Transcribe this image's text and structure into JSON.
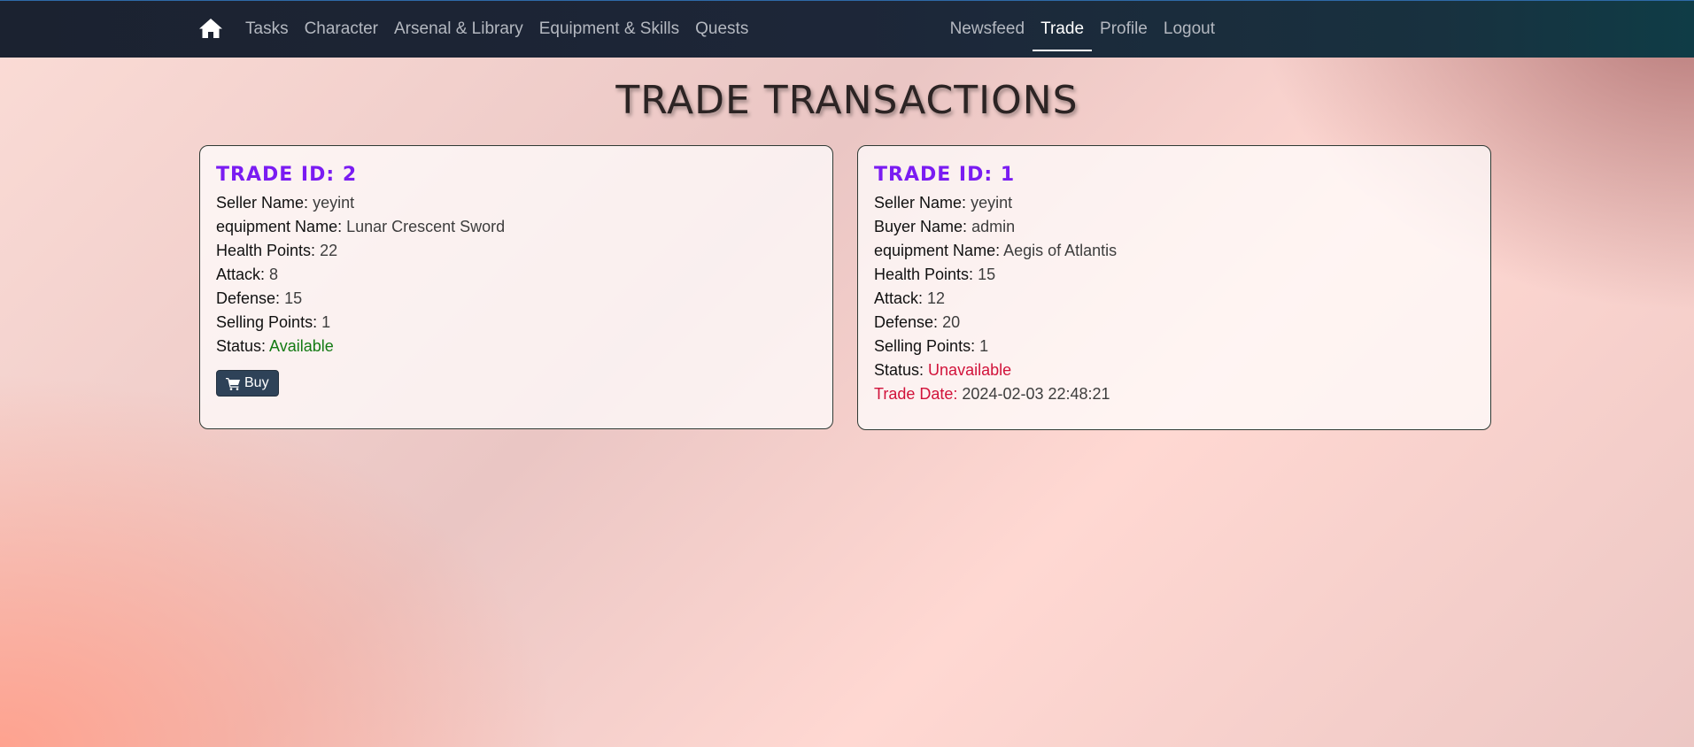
{
  "nav": {
    "left_items": [
      {
        "label": "Tasks"
      },
      {
        "label": "Character"
      },
      {
        "label": "Arsenal & Library"
      },
      {
        "label": "Equipment & Skills"
      },
      {
        "label": "Quests"
      }
    ],
    "right_items": [
      {
        "label": "Newsfeed"
      },
      {
        "label": "Trade",
        "active": true
      },
      {
        "label": "Profile"
      },
      {
        "label": "Logout"
      }
    ]
  },
  "page": {
    "title": "TRADE TRANSACTIONS"
  },
  "trades": [
    {
      "title": "TRADE ID: 2",
      "seller_label": "Seller Name:",
      "seller": "yeyint",
      "equipment_label": "equipment Name:",
      "equipment": "Lunar Crescent Sword",
      "hp_label": "Health Points:",
      "hp": "22",
      "attack_label": "Attack:",
      "attack": "8",
      "defense_label": "Defense:",
      "defense": "15",
      "sp_label": "Selling Points:",
      "sp": "1",
      "status_label": "Status:",
      "status": "Available",
      "buy_label": "Buy"
    },
    {
      "title": "TRADE ID: 1",
      "seller_label": "Seller Name:",
      "seller": "yeyint",
      "buyer_label": "Buyer Name:",
      "buyer": "admin",
      "equipment_label": "equipment Name:",
      "equipment": "Aegis of Atlantis",
      "hp_label": "Health Points:",
      "hp": "15",
      "attack_label": "Attack:",
      "attack": "12",
      "defense_label": "Defense:",
      "defense": "20",
      "sp_label": "Selling Points:",
      "sp": "1",
      "status_label": "Status:",
      "status": "Unavailable",
      "date_label": "Trade Date:",
      "date": "2024-02-03 22:48:21"
    }
  ],
  "icons": {
    "home": "home-icon",
    "cart": "cart-icon"
  },
  "colors": {
    "trade_title": "#7a1cf2",
    "available": "#137a13",
    "unavailable": "#d1123a",
    "buy_button": "#2e4258"
  }
}
